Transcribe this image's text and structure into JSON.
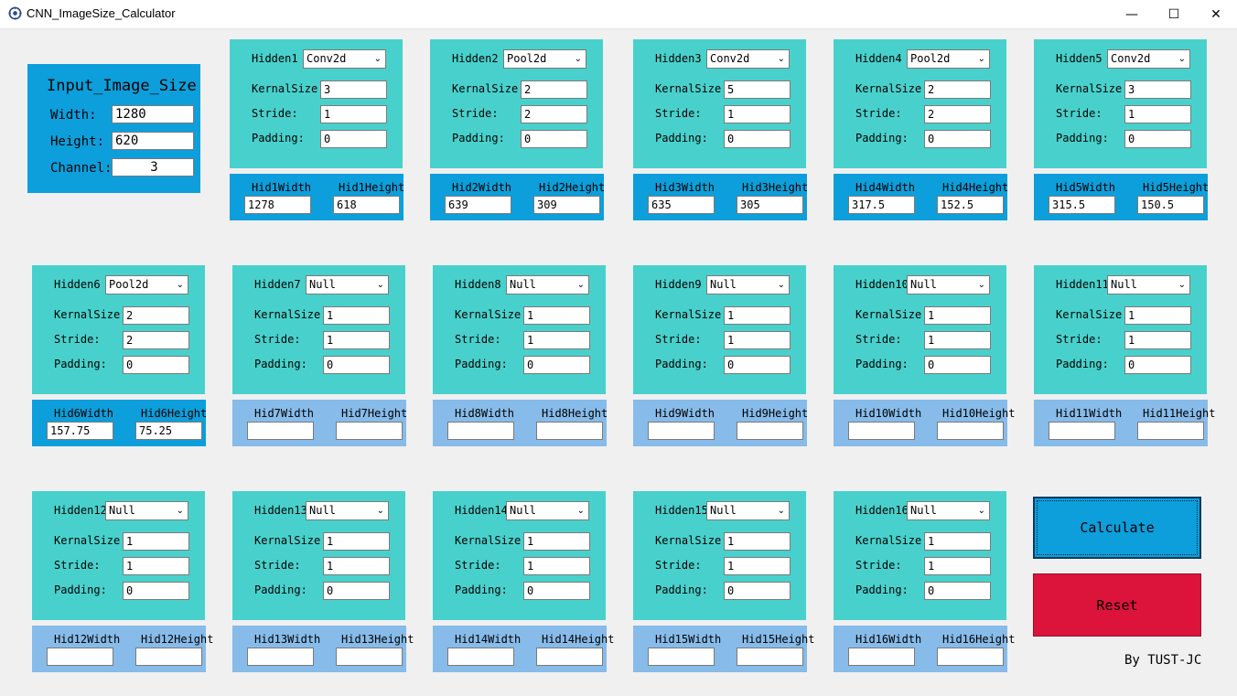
{
  "window": {
    "title": "CNN_ImageSize_Calculator",
    "controls": {
      "minimize": "—",
      "maximize": "☐",
      "close": "✕"
    }
  },
  "input": {
    "title": "Input_Image_Size",
    "width_label": "Width:",
    "width": "1280",
    "height_label": "Height:",
    "height": "620",
    "channel_label": "Channel:",
    "channel": "3"
  },
  "hidden": [
    {
      "name": "Hidden1",
      "type": "Conv2d",
      "kernel": "3",
      "stride": "1",
      "padding": "0",
      "w_label": "Hid1Width",
      "h_label": "Hid1Height",
      "w": "1278",
      "h": "618"
    },
    {
      "name": "Hidden2",
      "type": "Pool2d",
      "kernel": "2",
      "stride": "2",
      "padding": "0",
      "w_label": "Hid2Width",
      "h_label": "Hid2Height",
      "w": "639",
      "h": "309"
    },
    {
      "name": "Hidden3",
      "type": "Conv2d",
      "kernel": "5",
      "stride": "1",
      "padding": "0",
      "w_label": "Hid3Width",
      "h_label": "Hid3Height",
      "w": "635",
      "h": "305"
    },
    {
      "name": "Hidden4",
      "type": "Pool2d",
      "kernel": "2",
      "stride": "2",
      "padding": "0",
      "w_label": "Hid4Width",
      "h_label": "Hid4Height",
      "w": "317.5",
      "h": "152.5"
    },
    {
      "name": "Hidden5",
      "type": "Conv2d",
      "kernel": "3",
      "stride": "1",
      "padding": "0",
      "w_label": "Hid5Width",
      "h_label": "Hid5Height",
      "w": "315.5",
      "h": "150.5"
    },
    {
      "name": "Hidden6",
      "type": "Pool2d",
      "kernel": "2",
      "stride": "2",
      "padding": "0",
      "w_label": "Hid6Width",
      "h_label": "Hid6Height",
      "w": "157.75",
      "h": "75.25"
    },
    {
      "name": "Hidden7",
      "type": "Null",
      "kernel": "1",
      "stride": "1",
      "padding": "0",
      "w_label": "Hid7Width",
      "h_label": "Hid7Height",
      "w": "",
      "h": ""
    },
    {
      "name": "Hidden8",
      "type": "Null",
      "kernel": "1",
      "stride": "1",
      "padding": "0",
      "w_label": "Hid8Width",
      "h_label": "Hid8Height",
      "w": "",
      "h": ""
    },
    {
      "name": "Hidden9",
      "type": "Null",
      "kernel": "1",
      "stride": "1",
      "padding": "0",
      "w_label": "Hid9Width",
      "h_label": "Hid9Height",
      "w": "",
      "h": ""
    },
    {
      "name": "Hidden10",
      "type": "Null",
      "kernel": "1",
      "stride": "1",
      "padding": "0",
      "w_label": "Hid10Width",
      "h_label": "Hid10Height",
      "w": "",
      "h": ""
    },
    {
      "name": "Hidden11",
      "type": "Null",
      "kernel": "1",
      "stride": "1",
      "padding": "0",
      "w_label": "Hid11Width",
      "h_label": "Hid11Height",
      "w": "",
      "h": ""
    },
    {
      "name": "Hidden12",
      "type": "Null",
      "kernel": "1",
      "stride": "1",
      "padding": "0",
      "w_label": "Hid12Width",
      "h_label": "Hid12Height",
      "w": "",
      "h": ""
    },
    {
      "name": "Hidden13",
      "type": "Null",
      "kernel": "1",
      "stride": "1",
      "padding": "0",
      "w_label": "Hid13Width",
      "h_label": "Hid13Height",
      "w": "",
      "h": ""
    },
    {
      "name": "Hidden14",
      "type": "Null",
      "kernel": "1",
      "stride": "1",
      "padding": "0",
      "w_label": "Hid14Width",
      "h_label": "Hid14Height",
      "w": "",
      "h": ""
    },
    {
      "name": "Hidden15",
      "type": "Null",
      "kernel": "1",
      "stride": "1",
      "padding": "0",
      "w_label": "Hid15Width",
      "h_label": "Hid15Height",
      "w": "",
      "h": ""
    },
    {
      "name": "Hidden16",
      "type": "Null",
      "kernel": "1",
      "stride": "1",
      "padding": "0",
      "w_label": "Hid16Width",
      "h_label": "Hid16Height",
      "w": "",
      "h": ""
    }
  ],
  "labels": {
    "kernel": "KernalSize:",
    "stride": "Stride:",
    "padding": "Padding:"
  },
  "actions": {
    "calculate": "Calculate",
    "reset": "Reset"
  },
  "footer": "By TUST-JC",
  "colors": {
    "input_panel": "#0c9fdb",
    "hidden_panel": "#48d1cc",
    "output_active": "#0c9fdb",
    "output_inactive": "#87bbe9",
    "reset": "#dc143c"
  }
}
